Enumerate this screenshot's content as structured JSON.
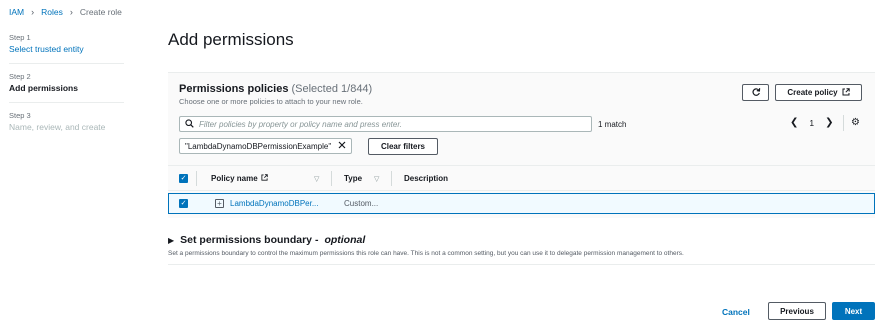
{
  "breadcrumb": {
    "items": [
      "IAM",
      "Roles",
      "Create role"
    ]
  },
  "steps": [
    {
      "num": "Step 1",
      "title": "Select trusted entity",
      "state": "link"
    },
    {
      "num": "Step 2",
      "title": "Add permissions",
      "state": "active"
    },
    {
      "num": "Step 3",
      "title": "Name, review, and create",
      "state": "disabled"
    }
  ],
  "page_title": "Add permissions",
  "policies": {
    "title": "Permissions policies",
    "selected": "(Selected 1/844)",
    "subtitle": "Choose one or more policies to attach to your new role.",
    "create_label": "Create policy",
    "search_placeholder": "Filter policies by property or policy name and press enter.",
    "match_text": "1 match",
    "page_number": "1",
    "filter_token": "\"LambdaDynamoDBPermissionExample\"",
    "clear_filters_label": "Clear filters",
    "columns": [
      "Policy name",
      "Type",
      "Description"
    ],
    "rows": [
      {
        "name": "LambdaDynamoDBPer...",
        "type": "Custom...",
        "description": "",
        "checked": true
      }
    ]
  },
  "boundary": {
    "title": "Set permissions boundary -",
    "optional": "optional",
    "description": "Set a permissions boundary to control the maximum permissions this role can have. This is not a common setting, but you can use it to delegate permission management to others."
  },
  "footer": {
    "cancel_label": "Cancel",
    "previous_label": "Previous",
    "next_label": "Next"
  },
  "colors": {
    "link": "#0073bb",
    "primary": "#0073bb",
    "selected_row_bg": "#f1faff"
  },
  "icons": [
    "chevron-right-icon",
    "refresh-icon",
    "external-link-icon",
    "search-icon",
    "chevron-left-icon",
    "settings-icon",
    "close-icon",
    "checkbox-checked-icon",
    "sort-down-icon",
    "expand-icon",
    "caret-right-icon"
  ]
}
